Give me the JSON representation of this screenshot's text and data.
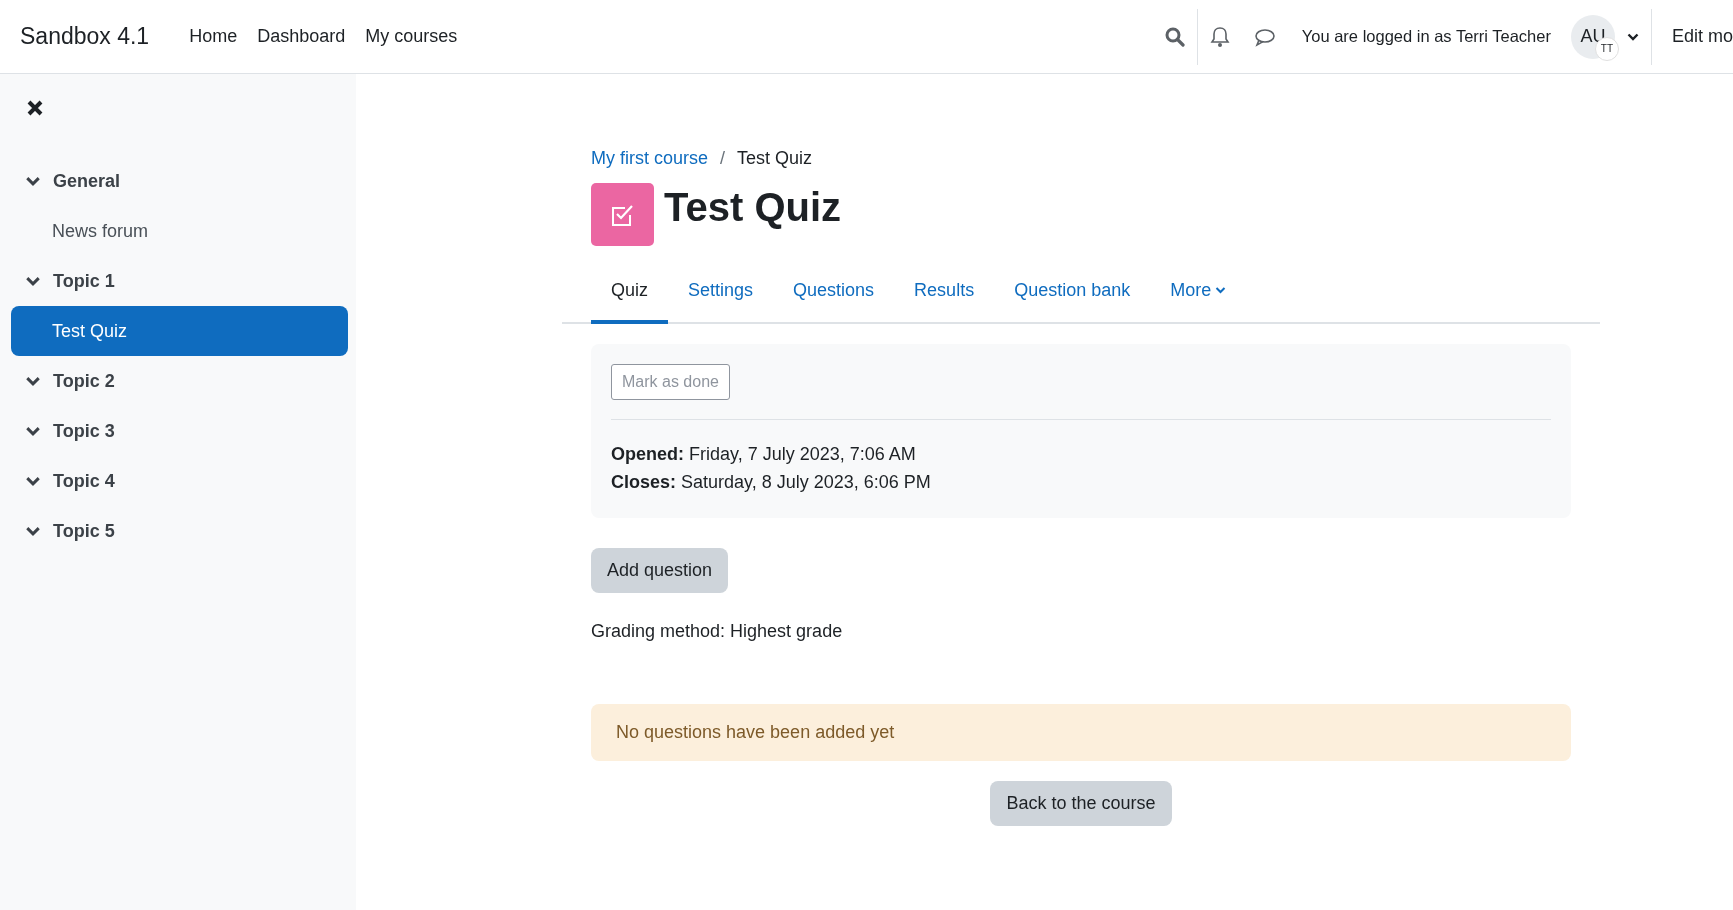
{
  "header": {
    "site_name": "Sandbox 4.1",
    "nav": [
      {
        "label": "Home"
      },
      {
        "label": "Dashboard"
      },
      {
        "label": "My courses"
      }
    ],
    "user_text": "You are logged in as Terri Teacher",
    "avatar": {
      "initials": "AU",
      "badge": "TT"
    },
    "edit_mode": "Edit mo"
  },
  "sidebar": {
    "sections": [
      {
        "title": "General",
        "expanded": true,
        "children": [
          {
            "label": "News forum",
            "selected": false
          }
        ]
      },
      {
        "title": "Topic 1",
        "expanded": true,
        "children": [
          {
            "label": "Test Quiz",
            "selected": true
          }
        ]
      },
      {
        "title": "Topic 2",
        "expanded": true
      },
      {
        "title": "Topic 3",
        "expanded": true
      },
      {
        "title": "Topic 4",
        "expanded": true
      },
      {
        "title": "Topic 5",
        "expanded": true
      }
    ]
  },
  "breadcrumb": [
    {
      "label": "My first course",
      "kind": "link"
    },
    {
      "label": "Test Quiz",
      "kind": "current"
    }
  ],
  "breadcrumb_separator": "/",
  "page_title": "Test Quiz",
  "tabs": [
    {
      "label": "Quiz",
      "selected": true
    },
    {
      "label": "Settings",
      "selected": false
    },
    {
      "label": "Questions",
      "selected": false
    },
    {
      "label": "Results",
      "selected": false
    },
    {
      "label": "Question bank",
      "selected": false
    },
    {
      "label": "More",
      "selected": false,
      "dropdown": true
    }
  ],
  "activity": {
    "mark_done": "Mark as done",
    "dates": [
      {
        "label": "Opened:",
        "value": "Friday, 7 July 2023, 7:06 AM"
      },
      {
        "label": "Closes:",
        "value": "Saturday, 8 July 2023, 6:06 PM"
      }
    ]
  },
  "add_question": "Add question",
  "grading": "Grading method: Highest grade",
  "alert": "No questions have been added yet",
  "back_button": "Back to the course"
}
